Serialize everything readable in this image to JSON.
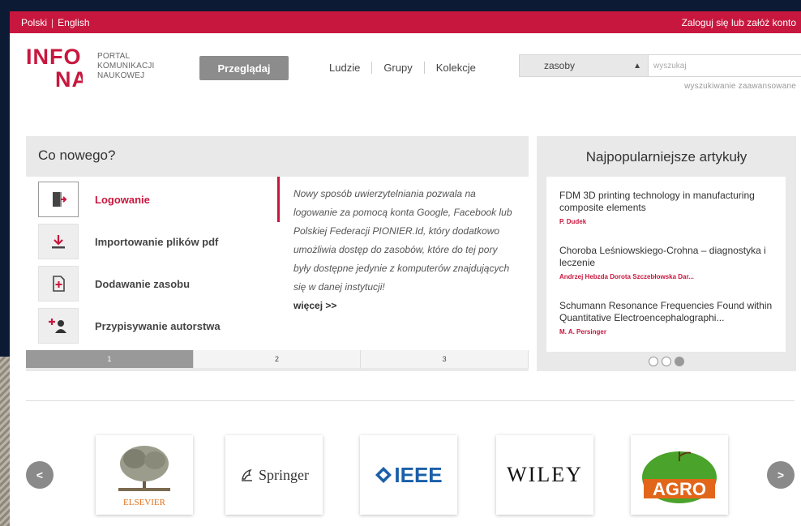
{
  "topbar": {
    "lang_pl": "Polski",
    "lang_sep": "|",
    "lang_en": "English",
    "login": "Zaloguj się lub załóż konto"
  },
  "header": {
    "logo_top": "INFO",
    "logo_bottom": "NA",
    "tagline": [
      "PORTAL",
      "KOMUNIKACJI",
      "NAUKOWEJ"
    ],
    "browse_label": "Przeglądaj",
    "nav": [
      "Ludzie",
      "Grupy",
      "Kolekcje"
    ],
    "search": {
      "select_value": "zasoby",
      "placeholder": "wyszukaj",
      "advanced": "wyszukiwanie zaawansowane"
    }
  },
  "news": {
    "title": "Co nowego?",
    "features": [
      {
        "label": "Logowanie",
        "icon": "login-door-icon"
      },
      {
        "label": "Importowanie plików pdf",
        "icon": "download-icon"
      },
      {
        "label": "Dodawanie zasobu",
        "icon": "add-document-icon"
      },
      {
        "label": "Przypisywanie autorstwa",
        "icon": "add-user-icon"
      }
    ],
    "description": "Nowy sposób uwierzytelniania pozwala na logowanie za pomocą konta Google, Facebook lub Polskiej Federacji PIONIER.Id, który dodatkowo umożliwia dostęp do zasobów, które do tej pory były dostępne jedynie z komputerów znajdujących się w danej instytucji!",
    "more": "więcej >>",
    "pages": [
      "1",
      "2",
      "3"
    ]
  },
  "popular": {
    "title": "Najpopularniejsze artykuły",
    "articles": [
      {
        "title": "FDM 3D printing technology in manufacturing composite elements",
        "authors": "P. Dudek"
      },
      {
        "title": "Choroba Leśniowskiego-Crohna – diagnostyka i leczenie",
        "authors": "Andrzej Hebzda Dorota Szczebłowska Dar..."
      },
      {
        "title": "Schumann Resonance Frequencies Found within Quantitative Electroencephalographi...",
        "authors": "M. A. Persinger"
      }
    ]
  },
  "partners": {
    "prev": "<",
    "next": ">",
    "logos": [
      "ELSEVIER",
      "Springer",
      "IEEE",
      "WILEY",
      "AGRO"
    ]
  },
  "colors": {
    "brand": "#c8173e",
    "gray_button": "#8c8c8c"
  }
}
